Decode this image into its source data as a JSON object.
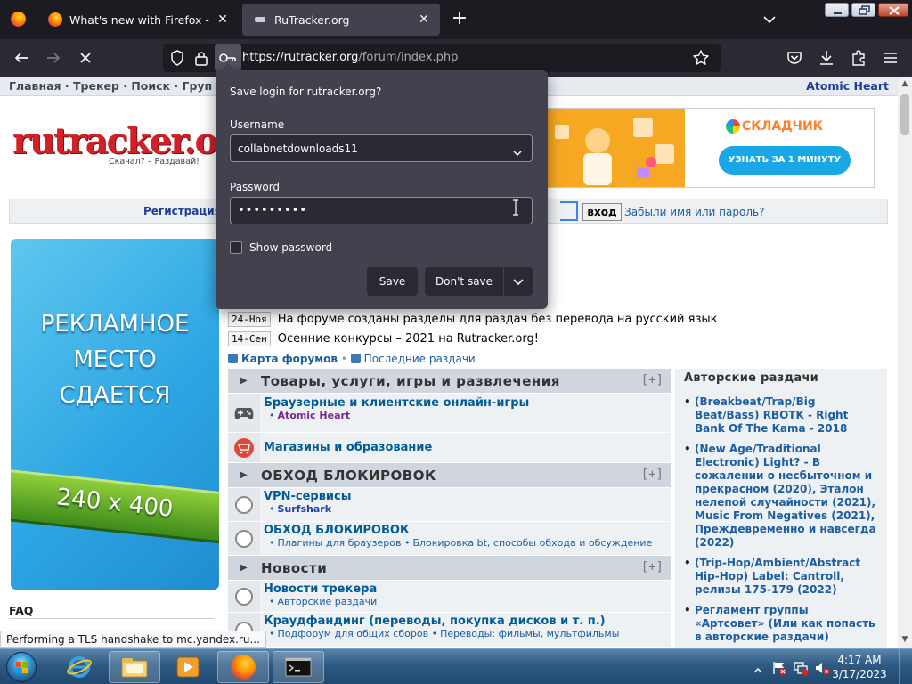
{
  "browser": {
    "tabs": [
      {
        "title": "What's new with Firefox - More"
      },
      {
        "title": "RuTracker.org"
      }
    ],
    "url": {
      "host": "https://rutracker.org",
      "path": "/forum/index.php"
    },
    "status_text": "Performing a TLS handshake to mc.yandex.ru..."
  },
  "page": {
    "topnav": {
      "links": "Главная · Трекер · Поиск · Груп",
      "right_link": "Atomic Heart"
    },
    "logo": {
      "text": "rutracker.org",
      "tagline": "Скачал? – Раздавай!"
    },
    "banner": {
      "brand": "СКЛАДЧИК",
      "button": "УЗНАТЬ ЗА 1 МИНУТУ"
    },
    "loginbar": {
      "register": "Регистрация",
      "login_button": "вход",
      "forgot": "Забыли имя или пароль?"
    },
    "side_ad": {
      "lines": [
        "РЕКЛАМНОЕ",
        "МЕСТО",
        "СДАЕТСЯ"
      ],
      "size": "240 x 400"
    },
    "faq": "FAQ",
    "news": [
      {
        "date": "24-Ноя",
        "text": "На форуме созданы разделы для раздач без перевода на русский язык"
      },
      {
        "date": "14-Сен",
        "text": "Осенние конкурсы – 2021 на Rutracker.org!"
      }
    ],
    "feeds": {
      "map": "Карта форумов",
      "latest": "Последние раздачи"
    },
    "categories": [
      {
        "title": "Товары, услуги, игры и развлечения",
        "plus": "[+]",
        "forums": [
          {
            "name": "Браузерные и клиентские онлайн-игры",
            "icon": "gamepad-icon",
            "subs": [
              "Atomic Heart"
            ]
          },
          {
            "name": "Магазины и образование",
            "icon": "shop-icon",
            "subs": []
          }
        ]
      },
      {
        "title": "ОБХОД БЛОКИРОВОК",
        "plus": "[+]",
        "forums": [
          {
            "name": "VPN-сервисы",
            "icon": "forum-circle-icon",
            "subs": [
              "Surfshark"
            ]
          },
          {
            "name": "ОБХОД БЛОКИРОВОК",
            "icon": "forum-circle-icon",
            "subs": [
              "Плагины для браузеров",
              "Блокировка bt, способы обхода и обсуждение"
            ]
          }
        ]
      },
      {
        "title": "Новости",
        "plus": "[+]",
        "forums": [
          {
            "name": "Новости трекера",
            "icon": "forum-circle-icon",
            "subs": [
              "Авторские раздачи"
            ]
          },
          {
            "name": "Краудфандинг (переводы, покупка дисков и т. п.)",
            "icon": "forum-circle-icon",
            "subs": [
              "Подфорум для общих сборов",
              "Переводы: фильмы, мультфильмы"
            ]
          }
        ]
      }
    ],
    "authors": {
      "heading": "Авторские раздачи",
      "items": [
        "(Breakbeat/Trap/Big Beat/Bass) RBOTK - Right Bank Of The Kama - 2018",
        "(New Age/Traditional Electronic) Light? - В сожалении о несбыточном и прекрасном (2020), Эталон нелепой случайности (2021), Music From Negatives (2021), Преждевременно и навсегда (2022)",
        "(Trip-Hop/Ambient/Abstract Hip-Hop) Label: Cantroll, релизы 175-179 (2022)",
        "Регламент группы «Артсовет» (Или как попасть в авторские раздачи)"
      ]
    }
  },
  "popup": {
    "title": "Save login for rutracker.org?",
    "username_label": "Username",
    "username_value": "collabnetdownloads11",
    "password_label": "Password",
    "password_value": "•••••••••",
    "show_password": "Show password",
    "save": "Save",
    "dont_save": "Don't save"
  },
  "taskbar": {
    "time": "4:17 AM",
    "date": "3/17/2023"
  }
}
